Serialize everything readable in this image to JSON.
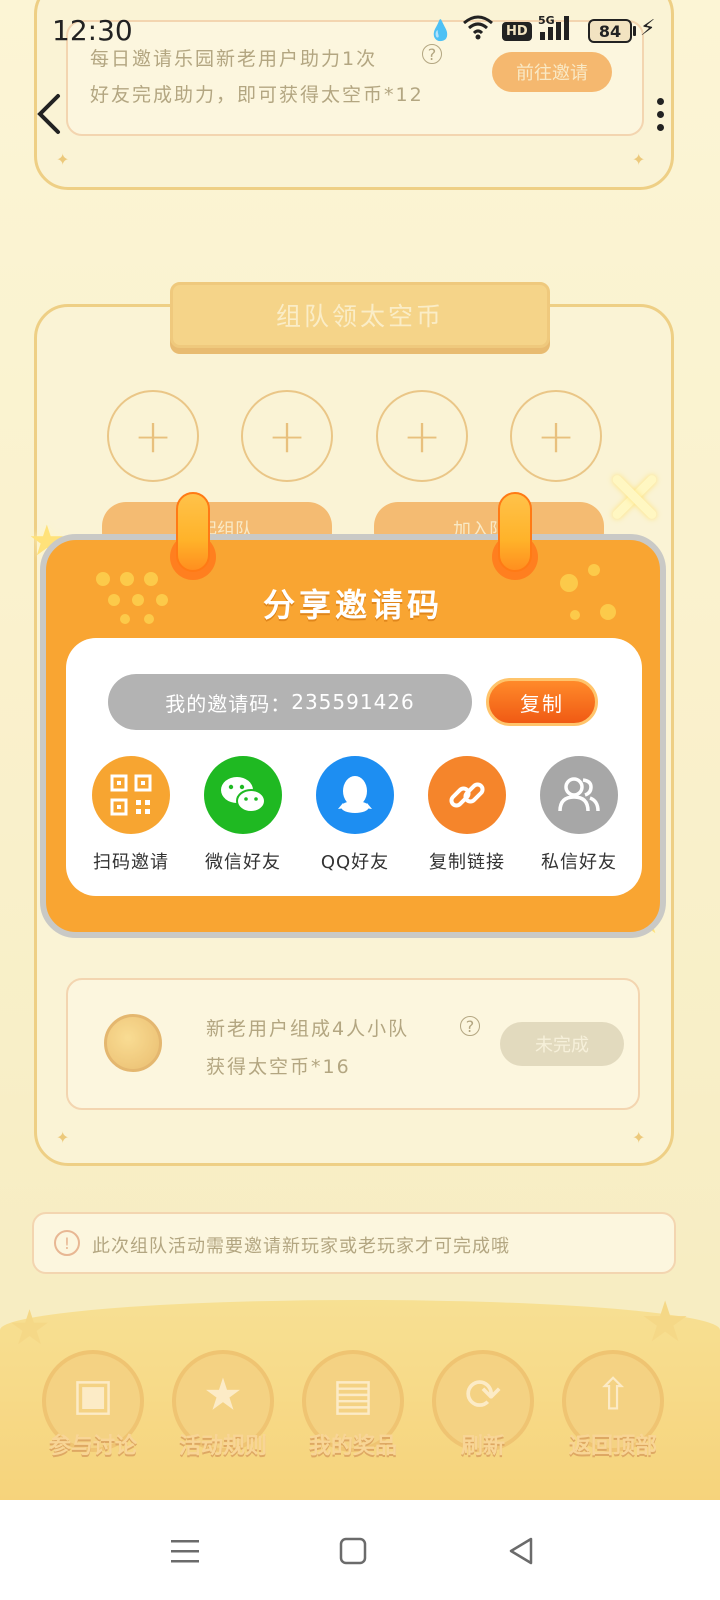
{
  "status_bar": {
    "time": "12:30",
    "battery": "84",
    "network": "5G"
  },
  "background": {
    "invite_task": {
      "line1": "每日邀请乐园新老用户助力1次",
      "line2": "好友完成助力，即可获得太空币*12",
      "button": "前往邀请"
    },
    "team_section": {
      "title": "组队领太空币",
      "create_button": "发起组队",
      "join_button": "加入队伍"
    },
    "team_task": {
      "line1": "新老用户组成4人小队",
      "line2": "获得太空币*16",
      "button": "未完成"
    },
    "notice": "此次组队活动需要邀请新玩家或老玩家才可完成哦",
    "bottom_nav": [
      "参与讨论",
      "活动规则",
      "我的奖品",
      "刷新",
      "返回顶部"
    ]
  },
  "modal": {
    "title": "分享邀请码",
    "invite_code_label": "我的邀请码：",
    "invite_code": "235591426",
    "copy_button": "复制",
    "share_options": [
      {
        "label": "扫码邀请",
        "icon": "qr-code-icon",
        "color": "#f7a531"
      },
      {
        "label": "微信好友",
        "icon": "wechat-icon",
        "color": "#1fb922"
      },
      {
        "label": "QQ好友",
        "icon": "qq-icon",
        "color": "#1d8ef2"
      },
      {
        "label": "复制链接",
        "icon": "link-icon",
        "color": "#f5852b"
      },
      {
        "label": "私信好友",
        "icon": "users-icon",
        "color": "#a7a7a7"
      }
    ]
  }
}
